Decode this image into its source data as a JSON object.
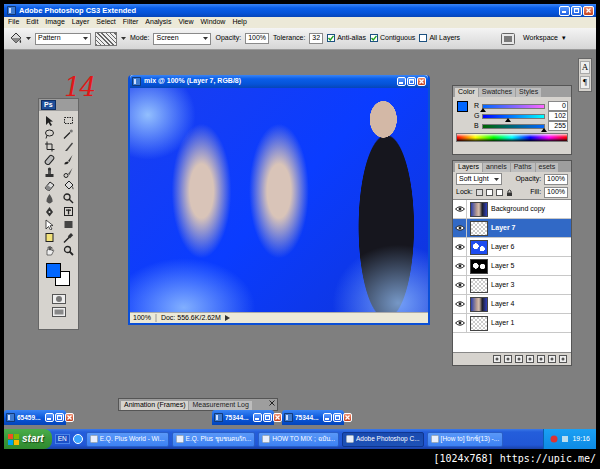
{
  "window": {
    "title": "Adobe Photoshop CS3 Extended"
  },
  "menu": [
    "File",
    "Edit",
    "Image",
    "Layer",
    "Select",
    "Filter",
    "Analysis",
    "View",
    "Window",
    "Help"
  ],
  "options": {
    "fill_source": "Pattern",
    "mode_label": "Mode:",
    "mode": "Screen",
    "opacity_label": "Opacity:",
    "opacity": "100%",
    "tolerance_label": "Tolerance:",
    "tolerance": "32",
    "checks": [
      {
        "label": "Anti-alias",
        "checked": true
      },
      {
        "label": "Contiguous",
        "checked": true
      },
      {
        "label": "All Layers",
        "checked": false
      }
    ],
    "workspace": "Workspace",
    "workspace_arrow": "▾"
  },
  "side_dock": [
    "A",
    "¶"
  ],
  "annotation": "14",
  "tools_panel": {
    "logo": "Ps",
    "foreground": "#0066ff",
    "background": "#ffffff"
  },
  "document": {
    "title": "mix @ 100% (Layer 7, RGB/8)",
    "zoom": "100%",
    "doc_info": "Doc: 556.6K/2.62M"
  },
  "color_panel": {
    "tabs": [
      {
        "label": "Color",
        "selected": true
      },
      {
        "label": "Swatches",
        "selected": false
      },
      {
        "label": "Styles",
        "selected": false
      }
    ],
    "foreground": "#0066ff",
    "channels": [
      {
        "name": "R",
        "value": "0",
        "level": 0
      },
      {
        "name": "G",
        "value": "102",
        "level": 0.4
      },
      {
        "name": "B",
        "value": "255",
        "level": 1
      }
    ]
  },
  "layers_panel": {
    "tabs": [
      {
        "label": "Layers",
        "selected": true
      },
      {
        "label": "annels",
        "selected": false
      },
      {
        "label": "Paths",
        "selected": false
      },
      {
        "label": "esets",
        "selected": false
      }
    ],
    "blend": "Soft Light",
    "opacity_label": "Opacity:",
    "opacity": "100%",
    "lock_label": "Lock:",
    "fill_label": "Fill:",
    "fill": "100%",
    "layers": [
      {
        "name": "Background copy",
        "selected": false,
        "visible": true,
        "kind": "photo"
      },
      {
        "name": "Layer 7",
        "selected": true,
        "visible": true,
        "kind": "empty"
      },
      {
        "name": "Layer 6",
        "selected": false,
        "visible": true,
        "kind": "blue"
      },
      {
        "name": "Layer 5",
        "selected": false,
        "visible": true,
        "kind": "mask"
      },
      {
        "name": "Layer 3",
        "selected": false,
        "visible": true,
        "kind": "empty"
      },
      {
        "name": "Layer 4",
        "selected": false,
        "visible": true,
        "kind": "photo"
      },
      {
        "name": "Layer 1",
        "selected": false,
        "visible": true,
        "kind": "empty"
      }
    ]
  },
  "bottom_panel": {
    "tabs": [
      {
        "label": "Animation (Frames)",
        "selected": true
      },
      {
        "label": "Measurement Log",
        "selected": false
      }
    ]
  },
  "minimized": [
    {
      "title": "65459..."
    },
    {
      "title": "75344..."
    },
    {
      "title": "75344..."
    }
  ],
  "taskbar": {
    "start": "start",
    "language": "EN",
    "items": [
      {
        "label": "E.Q. Plus World - Wi...",
        "selected": false
      },
      {
        "label": "E.Q. Plus ชุมชนคนรัก...",
        "selected": false
      },
      {
        "label": "HOW TO MIX ; ฉบับ...",
        "selected": false
      },
      {
        "label": "Adobe Photoshop C...",
        "selected": true
      },
      {
        "label": "[How to] มิกซ์(13) -...",
        "selected": false
      }
    ],
    "time": "19:16"
  },
  "caption": "[1024x768] https://upic.me/"
}
